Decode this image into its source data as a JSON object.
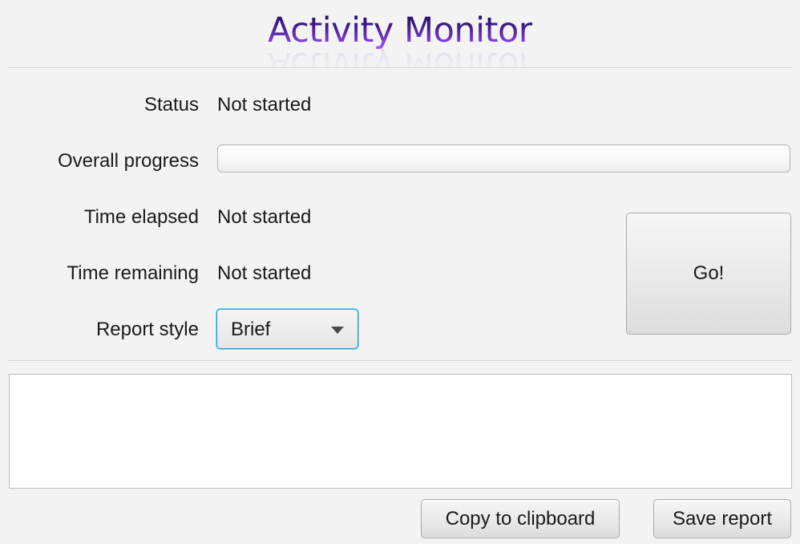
{
  "window": {
    "title": "Activity Monitor"
  },
  "form": {
    "status": {
      "label": "Status",
      "value": "Not started"
    },
    "overall_progress": {
      "label": "Overall progress",
      "value": 0
    },
    "time_elapsed": {
      "label": "Time elapsed",
      "value": "Not started"
    },
    "time_remaining": {
      "label": "Time remaining",
      "value": "Not started"
    },
    "report_style": {
      "label": "Report style",
      "selected": "Brief",
      "icon": "chevron-down-icon"
    }
  },
  "actions": {
    "go_label": "Go!",
    "copy_label": "Copy to clipboard",
    "save_label": "Save report"
  },
  "report": {
    "text": ""
  },
  "colors": {
    "title_dark": "#13095a",
    "title_light": "#b76cff",
    "focus_ring": "#1c9ad6",
    "background": "#f3f3f3"
  }
}
